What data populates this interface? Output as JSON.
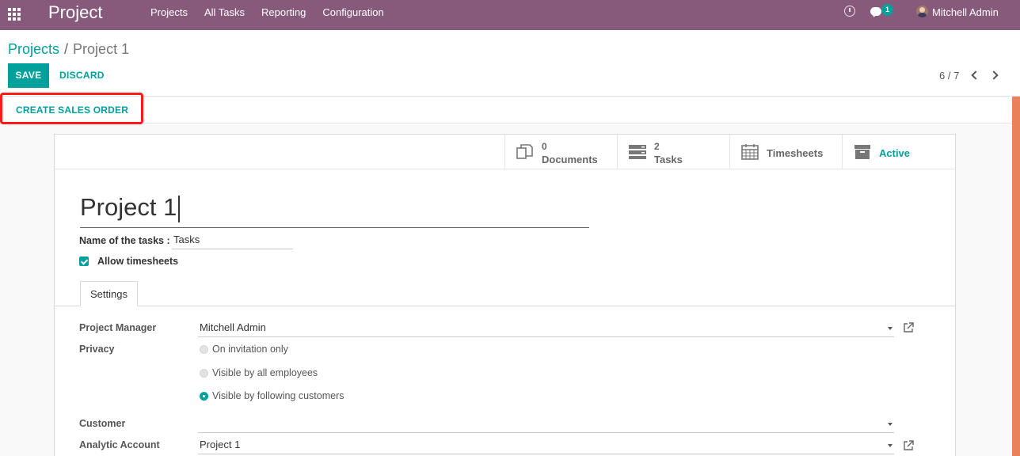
{
  "navbar": {
    "app_title": "Project",
    "menu": [
      "Projects",
      "All Tasks",
      "Reporting",
      "Configuration"
    ],
    "chat_badge": "1",
    "user_name": "Mitchell Admin"
  },
  "breadcrumb": {
    "parent": "Projects",
    "separator": "/",
    "current": "Project 1"
  },
  "actions": {
    "save": "SAVE",
    "discard": "DISCARD"
  },
  "pager": {
    "value": "6 / 7"
  },
  "statusbar": {
    "create_sales_order": "CREATE SALES ORDER"
  },
  "smart_buttons": {
    "documents": {
      "count": "0",
      "label": "Documents",
      "icon": "documents-icon"
    },
    "tasks": {
      "count": "2",
      "label": "Tasks",
      "icon": "tasks-icon"
    },
    "timesheets": {
      "label": "Timesheets",
      "icon": "calendar-icon"
    },
    "active": {
      "label": "Active",
      "icon": "archive-icon"
    }
  },
  "form": {
    "project_name": "Project 1",
    "task_name_label": "Name of the tasks :",
    "task_name_value": "Tasks",
    "allow_timesheets_label": "Allow timesheets",
    "allow_timesheets_checked": true,
    "tab_settings": "Settings",
    "project_manager_label": "Project Manager",
    "project_manager_value": "Mitchell Admin",
    "privacy_label": "Privacy",
    "privacy_options": [
      "On invitation only",
      "Visible by all employees",
      "Visible by following customers"
    ],
    "privacy_selected": "Visible by following customers",
    "customer_label": "Customer",
    "customer_value": "",
    "analytic_account_label": "Analytic Account",
    "analytic_account_value": "Project 1"
  },
  "colors": {
    "navbar": "#875a7b",
    "primary": "#00a09d",
    "highlight": "#ff1a1a"
  }
}
